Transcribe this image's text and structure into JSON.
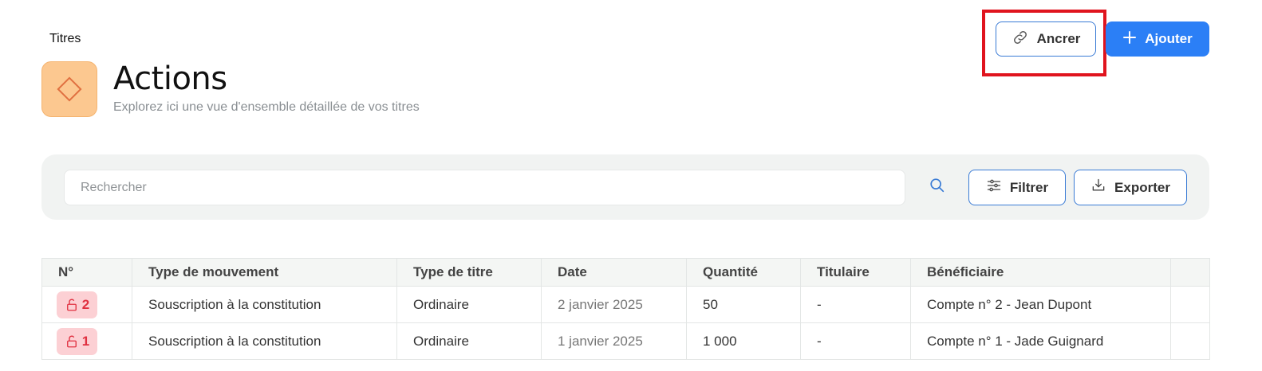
{
  "breadcrumb": "Titres",
  "header": {
    "title": "Actions",
    "subtitle": "Explorez ici une vue d'ensemble détaillée de vos titres",
    "icon": "diamond-icon",
    "icon_bg": "#fcc890",
    "icon_color": "#e07040"
  },
  "actions": {
    "anchor_label": "Ancrer",
    "add_label": "Ajouter"
  },
  "toolbar": {
    "search_placeholder": "Rechercher",
    "filter_label": "Filtrer",
    "export_label": "Exporter"
  },
  "table": {
    "columns": [
      "N°",
      "Type de mouvement",
      "Type de titre",
      "Date",
      "Quantité",
      "Titulaire",
      "Bénéficiaire",
      ""
    ],
    "rows": [
      {
        "num": "2",
        "movement": "Souscription à la constitution",
        "title_type": "Ordinaire",
        "date": "2 janvier 2025",
        "quantity": "50",
        "holder": "-",
        "beneficiary": "Compte n° 2 - Jean Dupont"
      },
      {
        "num": "1",
        "movement": "Souscription à la constitution",
        "title_type": "Ordinaire",
        "date": "1 janvier 2025",
        "quantity": "1 000",
        "holder": "-",
        "beneficiary": "Compte n° 1 - Jade Guignard"
      }
    ]
  },
  "colors": {
    "primary": "#2b7ff6",
    "highlight": "#e0141e",
    "badge_bg": "#fcd0d4",
    "badge_text": "#e03040"
  }
}
